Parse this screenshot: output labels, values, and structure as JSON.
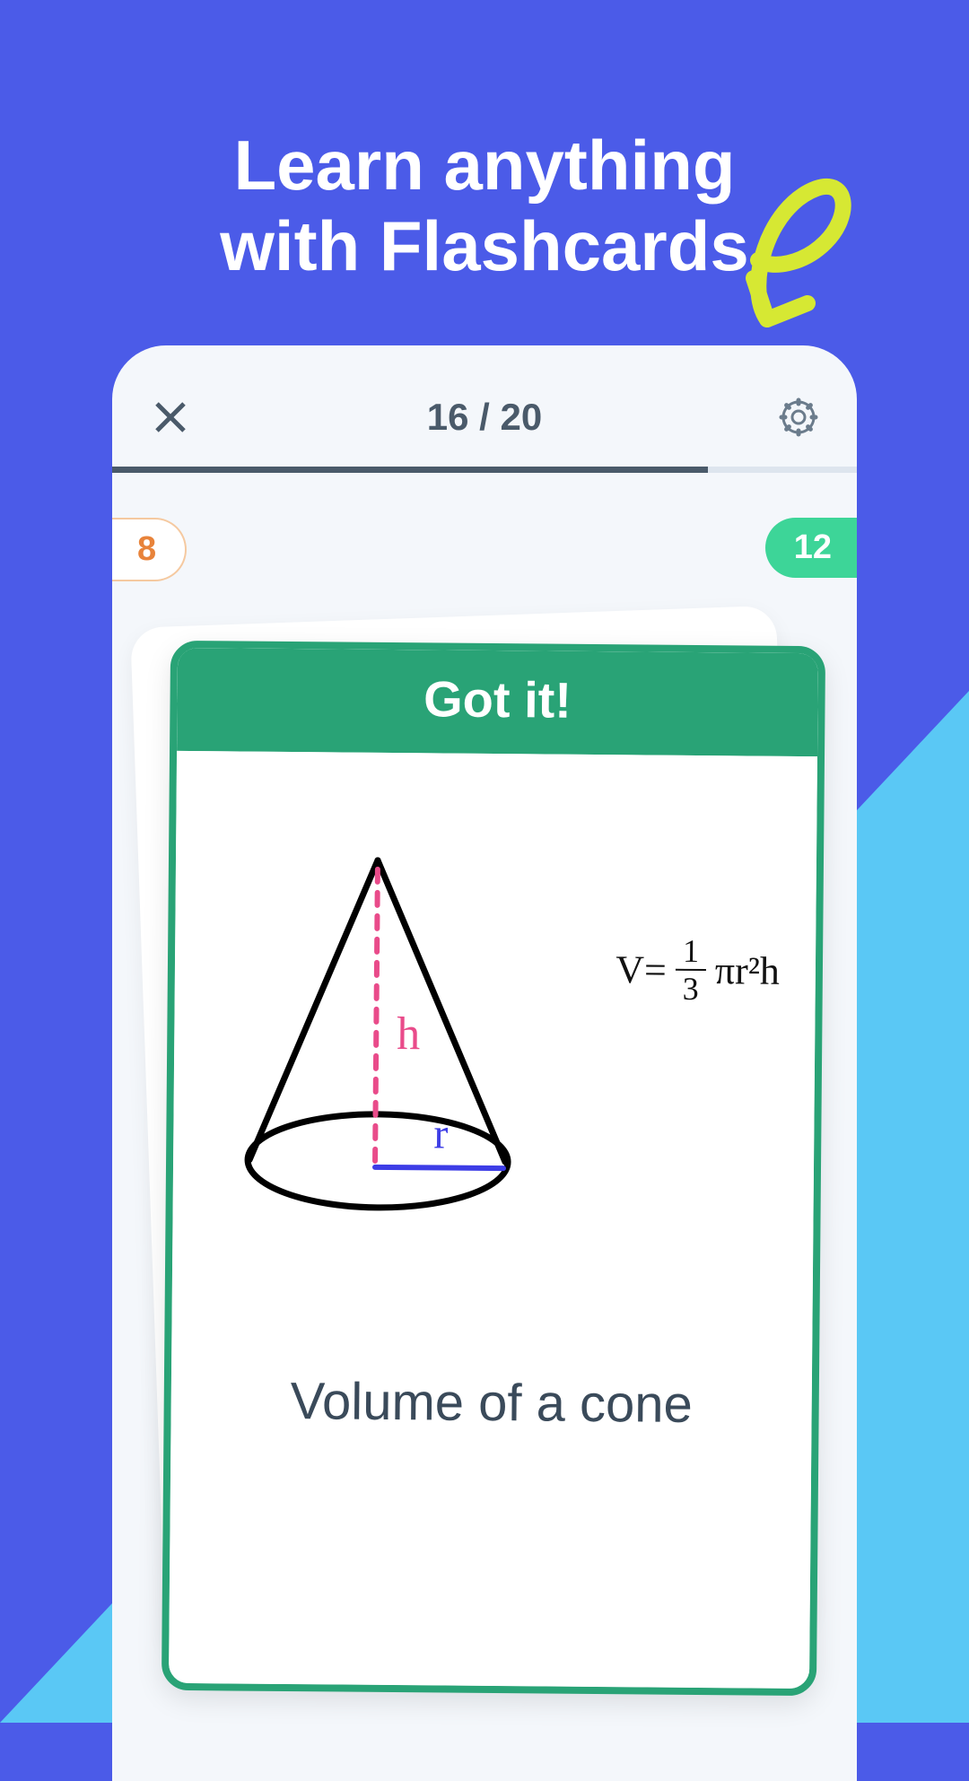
{
  "hero": {
    "line1": "Learn anything",
    "line2": "with Flashcards"
  },
  "progress": {
    "current": "16",
    "total": "20",
    "counter_text": "16 / 20",
    "bar_percent": 80,
    "left_badge": "8",
    "right_badge": "12"
  },
  "card": {
    "header": "Got it!",
    "caption": "Volume of a cone",
    "diagram": {
      "height_label": "h",
      "radius_label": "r"
    },
    "formula": {
      "lhs": "V=",
      "frac_top": "1",
      "frac_bot": "3",
      "rhs": "πr²h"
    }
  },
  "colors": {
    "bg_primary": "#4B5BE8",
    "bg_secondary": "#5AC8F5",
    "accent_green": "#29A376",
    "badge_green": "#3DD598",
    "badge_orange": "#E8833A",
    "arrow": "#D6E833"
  }
}
